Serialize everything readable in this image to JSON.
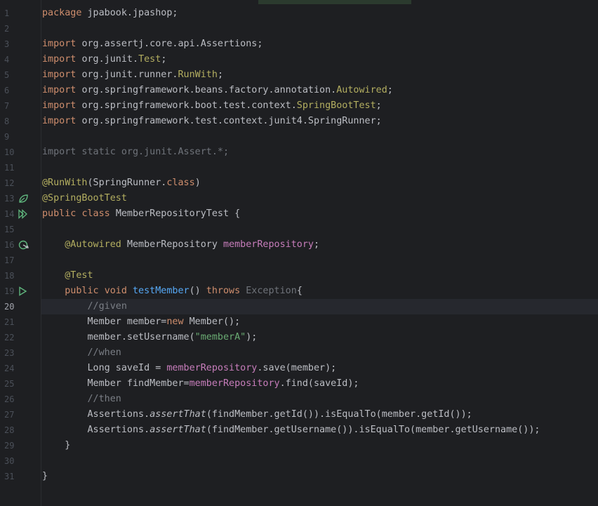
{
  "editor": {
    "current_line": 20,
    "lines": [
      {
        "n": "1",
        "tokens": [
          {
            "t": "package ",
            "c": "kw"
          },
          {
            "t": "jpabook.jpashop;",
            "c": ""
          }
        ]
      },
      {
        "n": "2",
        "tokens": []
      },
      {
        "n": "3",
        "tokens": [
          {
            "t": "import ",
            "c": "kw"
          },
          {
            "t": "org.assertj.core.api.Assertions;",
            "c": ""
          }
        ]
      },
      {
        "n": "4",
        "tokens": [
          {
            "t": "import ",
            "c": "kw"
          },
          {
            "t": "org.junit.",
            "c": ""
          },
          {
            "t": "Test",
            "c": "ann"
          },
          {
            "t": ";",
            "c": ""
          }
        ]
      },
      {
        "n": "5",
        "tokens": [
          {
            "t": "import ",
            "c": "kw"
          },
          {
            "t": "org.junit.runner.",
            "c": ""
          },
          {
            "t": "RunWith",
            "c": "ann"
          },
          {
            "t": ";",
            "c": ""
          }
        ]
      },
      {
        "n": "6",
        "tokens": [
          {
            "t": "import ",
            "c": "kw"
          },
          {
            "t": "org.springframework.beans.factory.annotation.",
            "c": ""
          },
          {
            "t": "Autowired",
            "c": "ann"
          },
          {
            "t": ";",
            "c": ""
          }
        ]
      },
      {
        "n": "7",
        "tokens": [
          {
            "t": "import ",
            "c": "kw"
          },
          {
            "t": "org.springframework.boot.test.context.",
            "c": ""
          },
          {
            "t": "SpringBootTest",
            "c": "ann"
          },
          {
            "t": ";",
            "c": ""
          }
        ]
      },
      {
        "n": "8",
        "tokens": [
          {
            "t": "import ",
            "c": "kw"
          },
          {
            "t": "org.springframework.test.context.junit4.SpringRunner;",
            "c": ""
          }
        ]
      },
      {
        "n": "9",
        "tokens": []
      },
      {
        "n": "10",
        "tokens": [
          {
            "t": "import static org.junit.Assert.*;",
            "c": "gray"
          }
        ]
      },
      {
        "n": "11",
        "tokens": []
      },
      {
        "n": "12",
        "tokens": [
          {
            "t": "@RunWith",
            "c": "ann"
          },
          {
            "t": "(SpringRunner.",
            "c": ""
          },
          {
            "t": "class",
            "c": "kw"
          },
          {
            "t": ")",
            "c": ""
          }
        ]
      },
      {
        "n": "13",
        "tokens": [
          {
            "t": "@SpringBootTest",
            "c": "ann"
          }
        ]
      },
      {
        "n": "14",
        "tokens": [
          {
            "t": "public ",
            "c": "kw"
          },
          {
            "t": "class ",
            "c": "kw"
          },
          {
            "t": "MemberRepositoryTest {",
            "c": ""
          }
        ]
      },
      {
        "n": "15",
        "tokens": []
      },
      {
        "n": "16",
        "tokens": [
          {
            "t": "    ",
            "c": ""
          },
          {
            "t": "@Autowired ",
            "c": "ann"
          },
          {
            "t": "MemberRepository ",
            "c": ""
          },
          {
            "t": "memberRepository",
            "c": "field"
          },
          {
            "t": ";",
            "c": ""
          }
        ]
      },
      {
        "n": "17",
        "tokens": []
      },
      {
        "n": "18",
        "tokens": [
          {
            "t": "    ",
            "c": ""
          },
          {
            "t": "@Test",
            "c": "ann"
          }
        ]
      },
      {
        "n": "19",
        "tokens": [
          {
            "t": "    ",
            "c": ""
          },
          {
            "t": "public ",
            "c": "kw"
          },
          {
            "t": "void ",
            "c": "kw"
          },
          {
            "t": "testMember",
            "c": "fn"
          },
          {
            "t": "() ",
            "c": ""
          },
          {
            "t": "throws ",
            "c": "kw"
          },
          {
            "t": "Exception",
            "c": "gray"
          },
          {
            "t": "{",
            "c": ""
          }
        ]
      },
      {
        "n": "20",
        "tokens": [
          {
            "t": "        ",
            "c": ""
          },
          {
            "t": "//given",
            "c": "cmt"
          }
        ]
      },
      {
        "n": "21",
        "tokens": [
          {
            "t": "        Member member=",
            "c": ""
          },
          {
            "t": "new ",
            "c": "kw"
          },
          {
            "t": "Member();",
            "c": ""
          }
        ]
      },
      {
        "n": "22",
        "tokens": [
          {
            "t": "        member.setUsername(",
            "c": ""
          },
          {
            "t": "\"memberA\"",
            "c": "str"
          },
          {
            "t": ");",
            "c": ""
          }
        ]
      },
      {
        "n": "23",
        "tokens": [
          {
            "t": "        ",
            "c": ""
          },
          {
            "t": "//when",
            "c": "cmt"
          }
        ]
      },
      {
        "n": "24",
        "tokens": [
          {
            "t": "        Long saveId = ",
            "c": ""
          },
          {
            "t": "memberRepository",
            "c": "field"
          },
          {
            "t": ".save(member);",
            "c": ""
          }
        ]
      },
      {
        "n": "25",
        "tokens": [
          {
            "t": "        Member findMember=",
            "c": ""
          },
          {
            "t": "memberRepository",
            "c": "field"
          },
          {
            "t": ".find(saveId);",
            "c": ""
          }
        ]
      },
      {
        "n": "26",
        "tokens": [
          {
            "t": "        ",
            "c": ""
          },
          {
            "t": "//then",
            "c": "cmt"
          }
        ]
      },
      {
        "n": "27",
        "tokens": [
          {
            "t": "        Assertions.",
            "c": ""
          },
          {
            "t": "assertThat",
            "c": "italic"
          },
          {
            "t": "(findMember.getId()).isEqualTo(member.getId());",
            "c": ""
          }
        ]
      },
      {
        "n": "28",
        "tokens": [
          {
            "t": "        Assertions.",
            "c": ""
          },
          {
            "t": "assertThat",
            "c": "italic"
          },
          {
            "t": "(findMember.getUsername()).isEqualTo(member.getUsername());",
            "c": ""
          }
        ]
      },
      {
        "n": "29",
        "tokens": [
          {
            "t": "    }",
            "c": ""
          }
        ]
      },
      {
        "n": "30",
        "tokens": []
      },
      {
        "n": "31",
        "tokens": [
          {
            "t": "}",
            "c": ""
          }
        ]
      }
    ]
  },
  "gutter_icons": [
    {
      "line": 13,
      "icon": "spring-bean-icon",
      "color": "#5fb57d"
    },
    {
      "line": 14,
      "icon": "run-class-icon",
      "color": "#5fb57d"
    },
    {
      "line": 16,
      "icon": "autowired-bean-icon",
      "color": "#5fb57d"
    },
    {
      "line": 19,
      "icon": "run-test-icon",
      "color": "#5fb57d"
    }
  ],
  "colors": {
    "background": "#1e1f22",
    "keyword": "#cf8e6d",
    "annotation": "#b3ae60",
    "method": "#56a8f5",
    "field": "#c77dbb",
    "string": "#6aab73",
    "comment": "#7a7e85"
  }
}
